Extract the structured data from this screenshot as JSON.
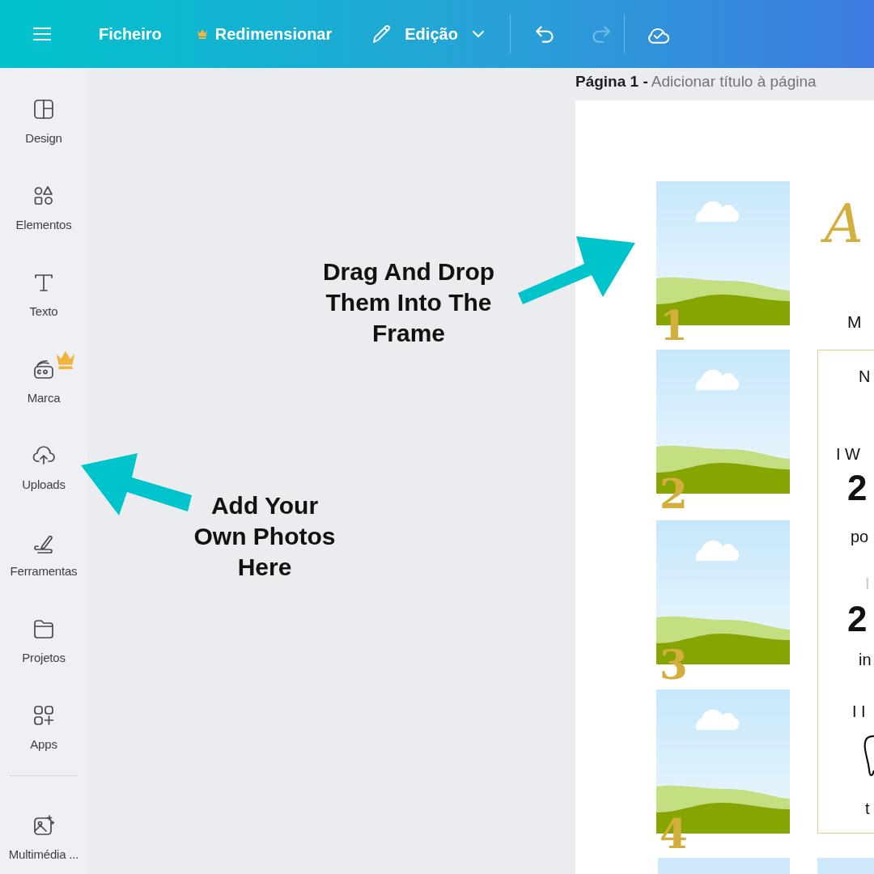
{
  "toolbar": {
    "file_menu": "Ficheiro",
    "resize": {
      "label": "Redimensionar",
      "premium": true
    },
    "edit_mode": {
      "label": "Edição"
    },
    "undo": {
      "disabled": false
    },
    "redo": {
      "disabled": true
    }
  },
  "sidebar": {
    "items": [
      {
        "label": "Design",
        "premium": false
      },
      {
        "label": "Elementos",
        "premium": false
      },
      {
        "label": "Texto",
        "premium": false
      },
      {
        "label": "Marca",
        "premium": true
      },
      {
        "label": "Uploads",
        "premium": false
      },
      {
        "label": "Ferramentas",
        "premium": false
      },
      {
        "label": "Projetos",
        "premium": false
      },
      {
        "label": "Apps",
        "premium": false
      }
    ],
    "bottom_items": [
      {
        "label": "Multimédia ...",
        "premium": false
      }
    ]
  },
  "page_header": {
    "page": "Página 1 -",
    "title_placeholder": "Adicionar título à página"
  },
  "canvas": {
    "photo_frames": [
      {
        "number": "1"
      },
      {
        "number": "2"
      },
      {
        "number": "3"
      },
      {
        "number": "4"
      }
    ],
    "heading_letter": "A",
    "subtitle": "M",
    "info_box": [
      {
        "text": "N",
        "kind": "label"
      },
      {
        "text": "I W",
        "kind": "label"
      },
      {
        "text": "2",
        "kind": "big"
      },
      {
        "text": "po",
        "kind": "label"
      },
      {
        "text": "I",
        "kind": "faint"
      },
      {
        "text": "2",
        "kind": "big"
      },
      {
        "text": "in",
        "kind": "label"
      },
      {
        "text": "I I",
        "kind": "label"
      },
      {
        "text": "t",
        "kind": "label"
      }
    ]
  },
  "annotations": [
    {
      "lines": [
        "Drag And Drop",
        "Them Into The",
        "Frame"
      ]
    },
    {
      "lines": [
        "Add Your",
        "Own Photos",
        "Here"
      ]
    }
  ]
}
